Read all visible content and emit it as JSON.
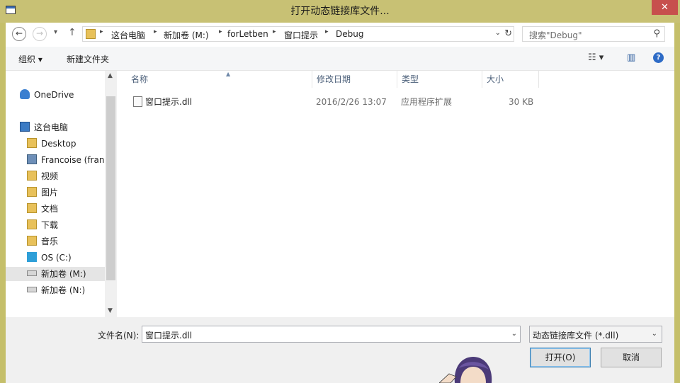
{
  "window": {
    "title": "打开动态链接库文件...",
    "close_glyph": "✕"
  },
  "nav": {
    "back_glyph": "←",
    "forward_glyph": "→",
    "recent_glyph": "▾",
    "up_glyph": "↑",
    "breadcrumb": [
      "这台电脑",
      "新加卷 (M:)",
      "forLetben",
      "窗口提示",
      "Debug"
    ],
    "sep_glyph": "▸",
    "dropdown_glyph": "⌄",
    "refresh_glyph": "↻",
    "search_placeholder": "搜索\"Debug\"",
    "search_glyph": "⚲"
  },
  "toolbar": {
    "organize_label": "组织 ▾",
    "new_folder_label": "新建文件夹",
    "view_glyph": "☷ ▾",
    "pane_glyph": "▥",
    "help_glyph": "?"
  },
  "sidebar": {
    "items": [
      {
        "label": "OneDrive",
        "icon": "cloud-icon"
      },
      {
        "label": "这台电脑",
        "icon": "computer-icon"
      },
      {
        "label": "Desktop",
        "icon": "folder-icon"
      },
      {
        "label": "Francoise (francoise-pc)",
        "icon": "network-computer-icon"
      },
      {
        "label": "视频",
        "icon": "folder-icon"
      },
      {
        "label": "图片",
        "icon": "folder-icon"
      },
      {
        "label": "文档",
        "icon": "folder-icon"
      },
      {
        "label": "下载",
        "icon": "folder-icon"
      },
      {
        "label": "音乐",
        "icon": "folder-icon"
      },
      {
        "label": "OS (C:)",
        "icon": "windows-drive-icon"
      },
      {
        "label": "新加卷 (M:)",
        "icon": "drive-icon"
      },
      {
        "label": "新加卷 (N:)",
        "icon": "drive-icon"
      }
    ],
    "scroll_up_glyph": "▲",
    "scroll_down_glyph": "▼"
  },
  "files": {
    "columns": [
      "名称",
      "修改日期",
      "类型",
      "大小"
    ],
    "sort_glyph": "▲",
    "rows": [
      {
        "name": "窗口提示.dll",
        "date": "2016/2/26 13:07",
        "type": "应用程序扩展",
        "size": "30 KB"
      }
    ]
  },
  "footer": {
    "filename_label": "文件名(N):",
    "filename_value": "窗口提示.dll",
    "filetype_value": "动态链接库文件 (*.dll)",
    "dropdown_glyph": "⌄",
    "open_label": "打开(O)",
    "cancel_label": "取消"
  },
  "colors": {
    "titlebar": "#c8c174",
    "close": "#c74f4d",
    "accent": "#2d6bc6"
  }
}
